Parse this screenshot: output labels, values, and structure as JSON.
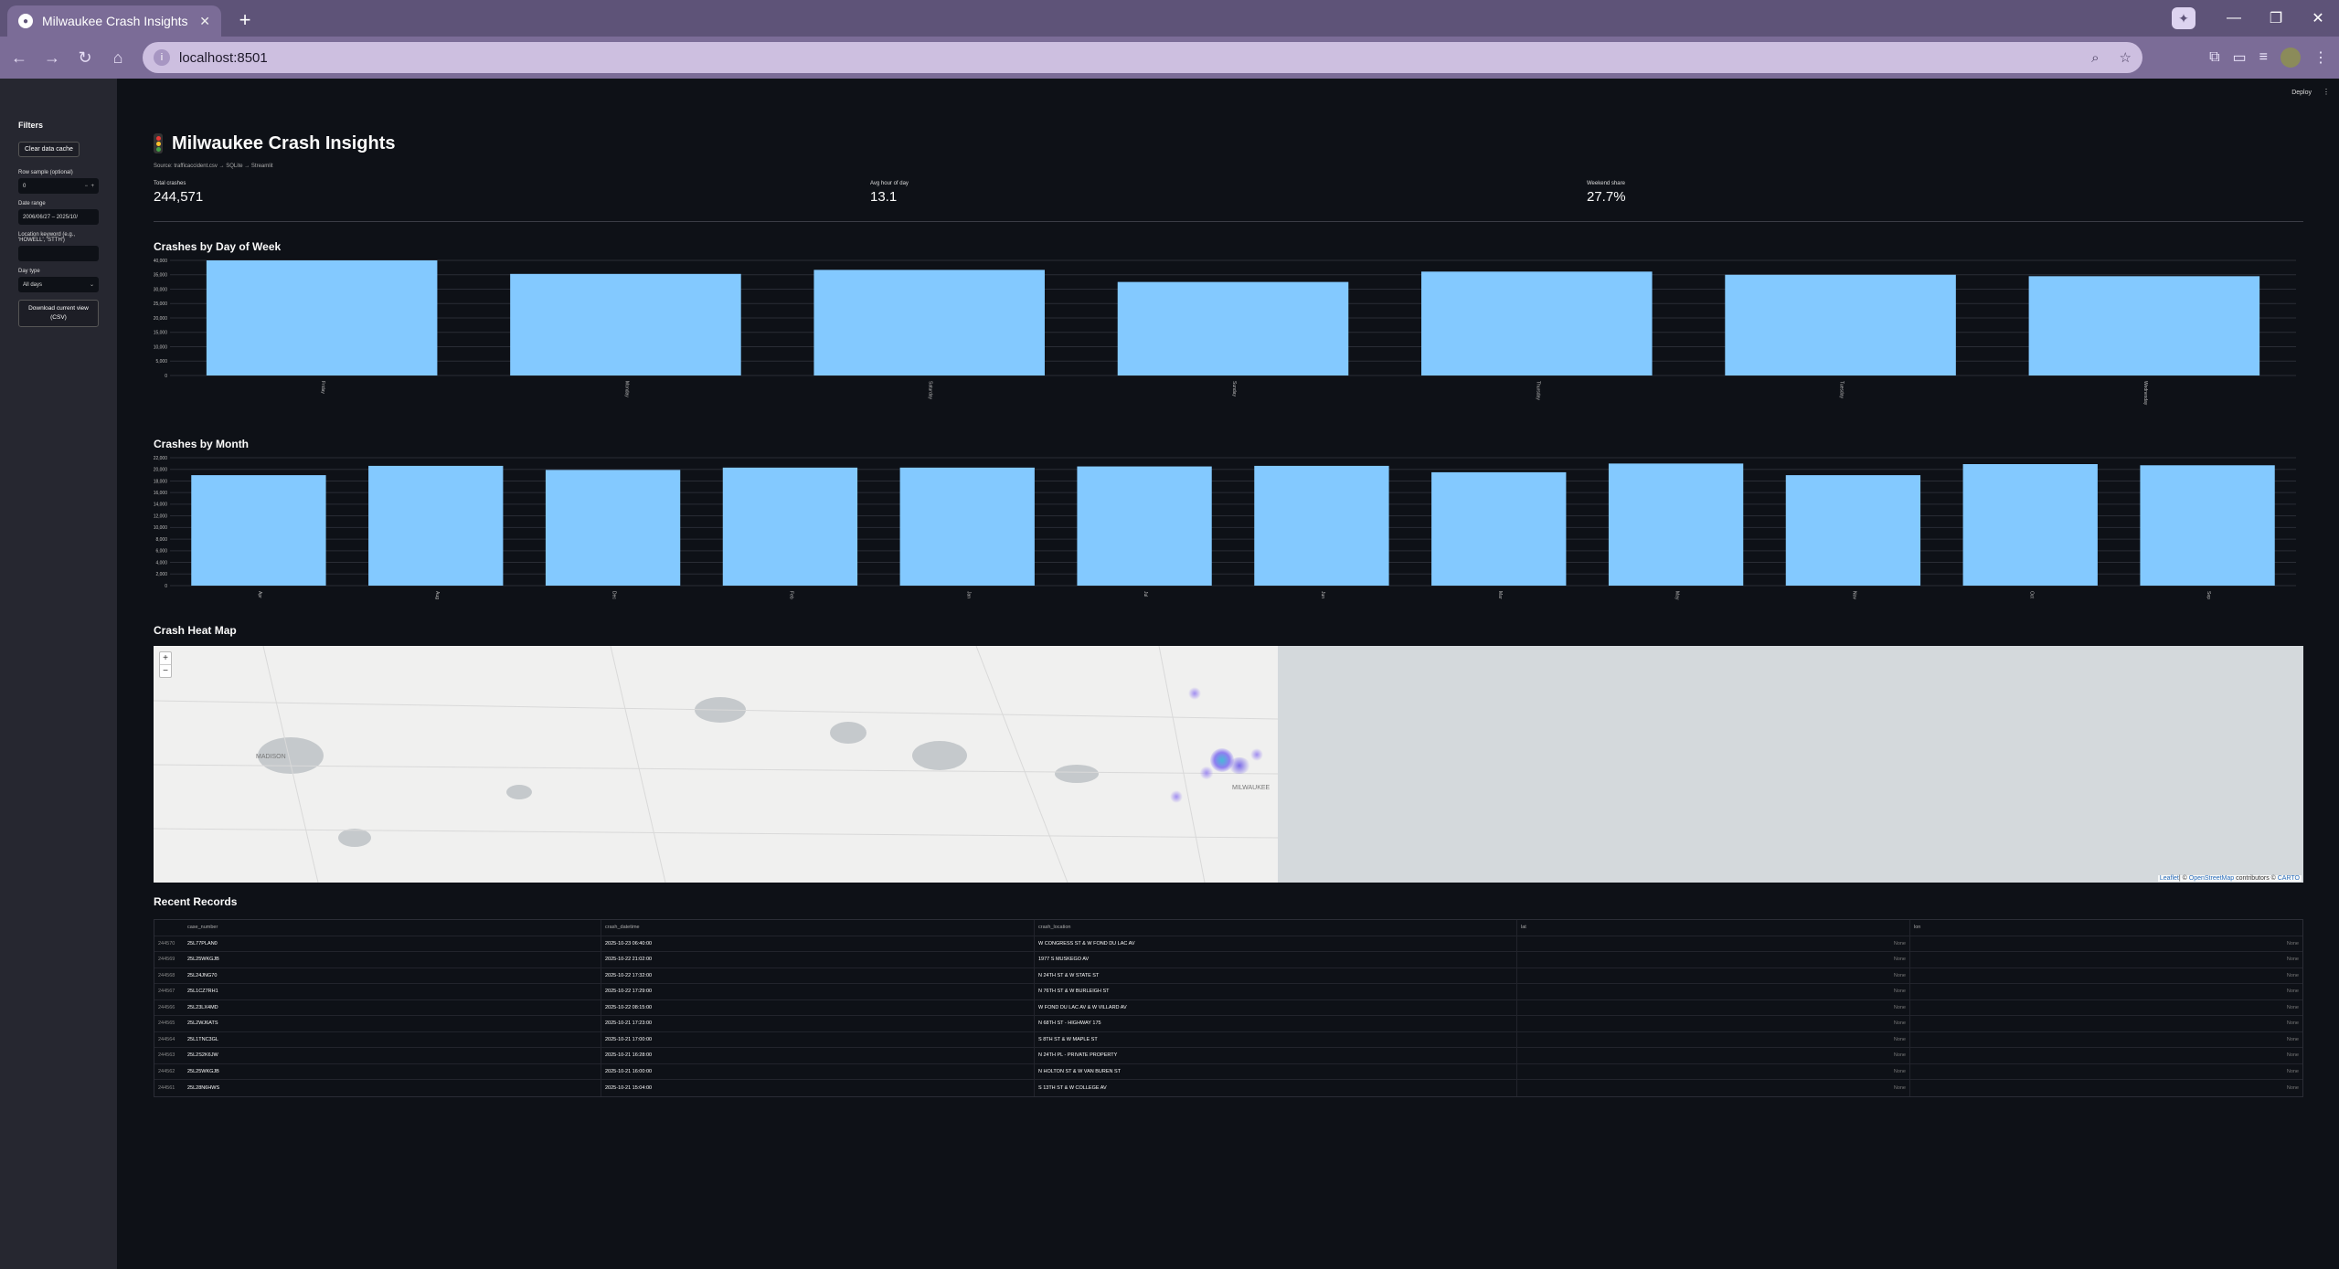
{
  "browser": {
    "tab_title": "Milwaukee Crash Insights",
    "url": "localhost:8501"
  },
  "sidebar": {
    "title": "Filters",
    "clear_cache_label": "Clear data cache",
    "row_sample_label": "Row sample (optional)",
    "row_sample_value": "0",
    "date_range_label": "Date range",
    "date_range_value": "2006/06/27 – 2025/10/",
    "location_label": "Location keyword (e.g., 'HOWELL', 'STTH')",
    "location_value": "",
    "day_type_label": "Day type",
    "day_type_value": "All days",
    "download_label": "Download current view (CSV)"
  },
  "header": {
    "deploy_label": "Deploy",
    "kebab": "⋮"
  },
  "page": {
    "title": "Milwaukee Crash Insights",
    "caption": "Source: trafficaccident.csv → SQLite → Streamlit",
    "metrics": [
      {
        "label": "Total crashes",
        "value": "244,571"
      },
      {
        "label": "Avg hour of day",
        "value": "13.1"
      },
      {
        "label": "Weekend share",
        "value": "27.7%"
      }
    ],
    "dow_title": "Crashes by Day of Week",
    "month_title": "Crashes by Month",
    "map_title": "Crash Heat Map",
    "records_title": "Recent Records"
  },
  "chart_data": [
    {
      "type": "bar",
      "title": "Crashes by Day of Week",
      "categories": [
        "Friday",
        "Monday",
        "Saturday",
        "Sunday",
        "Thursday",
        "Tuesday",
        "Wednesday"
      ],
      "values": [
        40000,
        35300,
        36700,
        32500,
        36100,
        35000,
        34500
      ],
      "ylim": [
        0,
        40000
      ],
      "yticks": [
        0,
        5000,
        10000,
        15000,
        20000,
        25000,
        30000,
        35000,
        40000
      ],
      "ytick_labels": [
        "0",
        "5,000",
        "10,000",
        "15,000",
        "20,000",
        "25,000",
        "30,000",
        "35,000",
        "40,000"
      ],
      "bar_color": "#83c9ff",
      "grid": true
    },
    {
      "type": "bar",
      "title": "Crashes by Month",
      "categories": [
        "Apr",
        "Aug",
        "Dec",
        "Feb",
        "Jan",
        "Jul",
        "Jun",
        "Mar",
        "May",
        "Nov",
        "Oct",
        "Sep"
      ],
      "values": [
        19000,
        20600,
        19900,
        20300,
        20300,
        20500,
        20600,
        19500,
        21000,
        19000,
        20900,
        20700
      ],
      "ylim": [
        0,
        22000
      ],
      "yticks": [
        0,
        2000,
        4000,
        6000,
        8000,
        10000,
        12000,
        14000,
        16000,
        18000,
        20000,
        22000
      ],
      "ytick_labels": [
        "0",
        "2,000",
        "4,000",
        "6,000",
        "8,000",
        "10,000",
        "12,000",
        "14,000",
        "16,000",
        "18,000",
        "20,000",
        "22,000"
      ],
      "bar_color": "#83c9ff",
      "grid": true
    }
  ],
  "map": {
    "zoom_in": "+",
    "zoom_out": "−",
    "attribution_leaflet": "Leaflet",
    "attribution_text": "| © ",
    "attribution_osm": "OpenStreetMap",
    "attribution_mid": " contributors © ",
    "attribution_carto": "CARTO",
    "city_label": "MILWAUKEE",
    "madison_label": "MADISON",
    "lake_color": "#d4d9dc"
  },
  "table": {
    "columns": [
      "",
      "case_number",
      "crash_datetime",
      "crash_location",
      "lat",
      "lon"
    ],
    "rows": [
      [
        "244570",
        "25L77PLAN0",
        "2025-10-23 06:40:00",
        "W CONGRESS ST & W FOND DU LAC AV",
        "None",
        "None"
      ],
      [
        "244569",
        "25L25WKGJB",
        "2025-10-22 21:02:00",
        "1977 S MUSKEGO AV",
        "None",
        "None"
      ],
      [
        "244568",
        "25L24JNG70",
        "2025-10-22 17:32:00",
        "N 24TH ST & W STATE ST",
        "None",
        "None"
      ],
      [
        "244567",
        "25L1CZ7RH1",
        "2025-10-22 17:29:00",
        "N 76TH ST & W BURLEIGH ST",
        "None",
        "None"
      ],
      [
        "244566",
        "25L23LX4MD",
        "2025-10-22 08:15:00",
        "W FOND DU LAC AV & W VILLARD AV",
        "None",
        "None"
      ],
      [
        "244565",
        "25L2WJ6ATS",
        "2025-10-21 17:23:00",
        "N 68TH ST - HIGHWAY 175",
        "None",
        "None"
      ],
      [
        "244564",
        "25L1TNC3GL",
        "2025-10-21 17:00:00",
        "S 8TH ST & W MAPLE ST",
        "None",
        "None"
      ],
      [
        "244563",
        "25L2S2K6JW",
        "2025-10-21 16:28:00",
        "N 24TH PL - PRIVATE PROPERTY",
        "None",
        "None"
      ],
      [
        "244562",
        "25L25WKGJB",
        "2025-10-21 16:00:00",
        "N HOLTON ST & W VAN BUREN ST",
        "None",
        "None"
      ],
      [
        "244561",
        "25L28N6HWS",
        "2025-10-21 15:04:00",
        "S 13TH ST & W COLLEGE AV",
        "None",
        "None"
      ]
    ]
  }
}
